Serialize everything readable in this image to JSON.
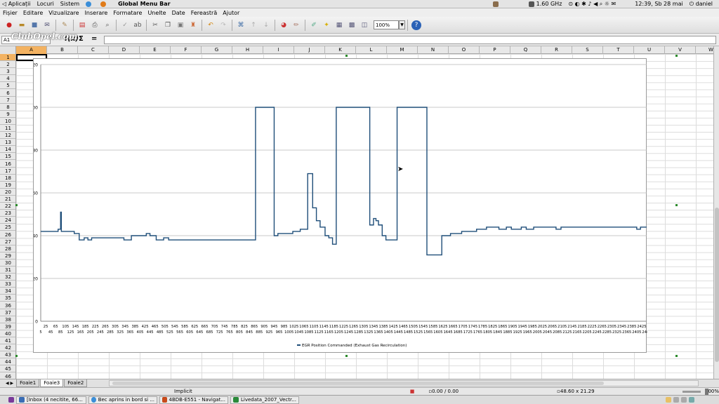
{
  "top_panel": {
    "app_menu": "Aplicații",
    "places_menu": "Locuri",
    "system_menu": "Sistem",
    "title": "Global Menu Bar",
    "cpu": "1.60 GHz",
    "clock": "12:39, Sb 28 mai",
    "user": "daniel"
  },
  "menubar": {
    "items": [
      "Fișier",
      "Editare",
      "Vizualizare",
      "Inserare",
      "Formatare",
      "Unelte",
      "Date",
      "Fereastră",
      "Ajutor"
    ]
  },
  "toolbar": {
    "zoom": "100%"
  },
  "formula_bar": {
    "cell_ref": "A1",
    "content": ""
  },
  "watermark": "ClubOpel.com",
  "columns": [
    "A",
    "B",
    "C",
    "D",
    "E",
    "F",
    "G",
    "H",
    "I",
    "J",
    "K",
    "L",
    "M",
    "N",
    "O",
    "P",
    "Q",
    "R",
    "S",
    "T",
    "U",
    "V",
    "W"
  ],
  "rows": [
    "1",
    "2",
    "3",
    "4",
    "5",
    "6",
    "7",
    "8",
    "9",
    "10",
    "11",
    "12",
    "13",
    "14",
    "15",
    "16",
    "17",
    "18",
    "19",
    "20",
    "21",
    "22",
    "23",
    "24",
    "25",
    "26",
    "27",
    "28",
    "29",
    "30",
    "31",
    "32",
    "33",
    "34",
    "35",
    "36",
    "37",
    "38",
    "39",
    "40",
    "41",
    "42",
    "43",
    "44",
    "45",
    "46"
  ],
  "chart_data": {
    "type": "line",
    "title": "",
    "xlabel": "",
    "ylabel": "",
    "ylim": [
      0,
      120
    ],
    "yticks": [
      0,
      20,
      40,
      60,
      80,
      100,
      120
    ],
    "grid": true,
    "legend": "bottom",
    "x_tick_labels_row1": [
      "25",
      "65",
      "105",
      "145",
      "185",
      "225",
      "265",
      "305",
      "345",
      "385",
      "425",
      "465",
      "505",
      "545",
      "585",
      "625",
      "665",
      "705",
      "745",
      "785",
      "825",
      "865",
      "905",
      "945",
      "985",
      "1025",
      "1065",
      "1105",
      "1145",
      "1185",
      "1225",
      "1265",
      "1305",
      "1345",
      "1385",
      "1425",
      "1465",
      "1505",
      "1545",
      "1585",
      "1625",
      "1665",
      "1705",
      "1745",
      "1785",
      "1825",
      "1865",
      "1905",
      "1945",
      "1985",
      "2025",
      "2065",
      "2105",
      "2145",
      "2185",
      "2225",
      "2265",
      "2305",
      "2345",
      "2385",
      "2425"
    ],
    "x_tick_labels_row2": [
      "5",
      "45",
      "85",
      "125",
      "165",
      "205",
      "245",
      "285",
      "325",
      "365",
      "405",
      "445",
      "485",
      "525",
      "565",
      "605",
      "645",
      "685",
      "725",
      "765",
      "805",
      "845",
      "885",
      "925",
      "965",
      "1005",
      "1045",
      "1085",
      "1125",
      "1165",
      "1205",
      "1245",
      "1285",
      "1325",
      "1365",
      "1405",
      "1445",
      "1485",
      "1525",
      "1565",
      "1605",
      "1645",
      "1685",
      "1725",
      "1765",
      "1805",
      "1845",
      "1885",
      "1925",
      "1965",
      "2005",
      "2045",
      "2085",
      "2125",
      "2165",
      "2205",
      "2245",
      "2285",
      "2325",
      "2365",
      "2405",
      "2445"
    ],
    "series": [
      {
        "name": "EGR Position Commanded (Exhaust Gas Recirculation)",
        "color": "#1f4e79",
        "x": [
          5,
          75,
          85,
          88,
          110,
          140,
          160,
          180,
          195,
          210,
          230,
          240,
          270,
          340,
          370,
          390,
          430,
          445,
          470,
          500,
          520,
          550,
          850,
          870,
          945,
          960,
          975,
          1020,
          1050,
          1080,
          1100,
          1115,
          1130,
          1150,
          1165,
          1180,
          1195,
          1215,
          1235,
          1250,
          1265,
          1330,
          1345,
          1355,
          1365,
          1380,
          1395,
          1410,
          1440,
          1470,
          1530,
          1560,
          1620,
          1640,
          1655,
          1700,
          1760,
          1800,
          1850,
          1880,
          1900,
          1940,
          1960,
          1980,
          1990,
          2005,
          2030,
          2080,
          2100,
          2140,
          2200,
          2405,
          2420,
          2445
        ],
        "values": [
          42,
          43,
          51,
          42,
          42,
          41,
          38,
          39,
          38,
          39,
          39,
          39,
          39,
          38,
          40,
          40,
          41,
          40,
          38,
          39,
          38,
          38,
          38,
          100,
          40,
          41,
          41,
          42,
          43,
          69,
          53,
          47,
          44,
          40,
          39,
          36,
          100,
          100,
          100,
          100,
          100,
          45,
          48,
          47,
          45,
          40,
          38,
          38,
          100,
          100,
          100,
          31,
          40,
          40,
          41,
          42,
          43,
          44,
          43,
          44,
          43,
          44,
          43,
          43,
          44,
          44,
          44,
          43,
          44,
          44,
          44,
          43,
          44,
          44
        ]
      }
    ]
  },
  "sheet_tabs": [
    "Foaie1",
    "Foaie3",
    "Foaie2"
  ],
  "active_tab": "Foaie3",
  "statusbar": {
    "mode": "Implicit",
    "position": "0.00 / 0.00",
    "size": "48.60 x 21.29",
    "zoom": "100%"
  },
  "taskbar": {
    "tasks": [
      "[Inbox (4 necitite, 66...",
      "Bec aprins in bord si ...",
      "4BDB-E551 - Navigat...",
      "Livedata_2007_Vectr..."
    ]
  }
}
